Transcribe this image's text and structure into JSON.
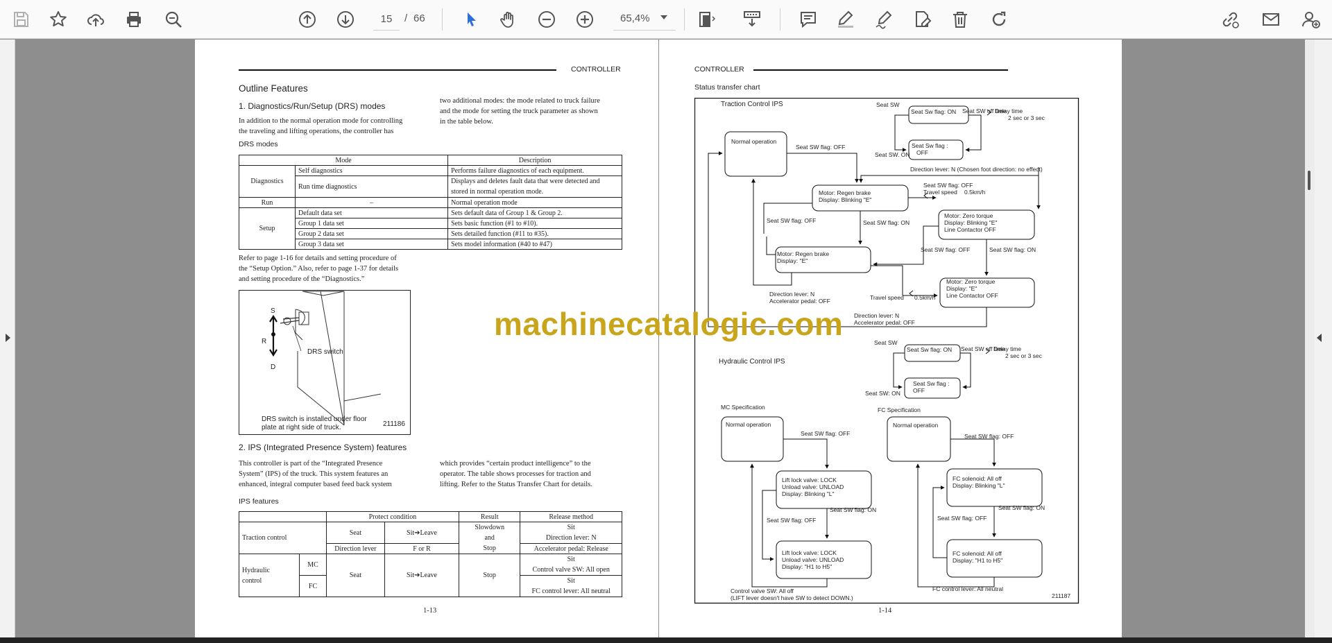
{
  "toolbar": {
    "current_page": "15",
    "page_sep": "/",
    "total_pages": "66",
    "zoom": "65,4%",
    "icons": [
      "save-icon",
      "bookmark-star-icon",
      "upload-cloud-icon",
      "print-icon",
      "zoom-search-icon",
      "page-up-icon",
      "page-down-icon",
      "select-cursor-icon",
      "hand-tool-icon",
      "zoom-out-icon",
      "zoom-in-icon",
      "fit-page-icon",
      "scroll-mode-icon",
      "comment-icon",
      "highlight-pen-icon",
      "sign-pen-icon",
      "edit-file-icon",
      "trash-icon",
      "rotate-icon",
      "share-link-icon",
      "mail-icon",
      "add-user-icon"
    ],
    "accent_color": "#2f6fd6"
  },
  "left_page": {
    "header": "CONTROLLER",
    "title": "Outline Features",
    "section1_title": "1.  Diagnostics/Run/Setup (DRS) modes",
    "para1_lines": [
      "In addition to the normal operation mode for controlling",
      "the traveling and lifting operations, the controller has"
    ],
    "para1b_lines": [
      "two additional modes: the mode related to truck failure",
      "and the mode for setting the truck parameter as shown",
      "in the table below."
    ],
    "drs_caption": "DRS modes",
    "drs_table": {
      "h_mode": "Mode",
      "h_desc": "Description",
      "diagnostics": "Diagnostics",
      "self_diag": "Self diagnostics",
      "self_diag_desc": "Performs failure diagnostics of each equipment.",
      "runtime_diag": "Run time diagnostics",
      "runtime_desc_1": "Displays and deletes fault data that were detected and",
      "runtime_desc_2": "stored in normal operation mode.",
      "run": "Run",
      "run_dash": "–",
      "run_desc": "Normal operation mode",
      "setup": "Setup",
      "default_set": "Default data set",
      "default_desc": "Sets default data of Group 1 & Group 2.",
      "g1": "Group 1 data set",
      "g1_desc": "Sets basic function (#1 to #10).",
      "g2": "Group 2 data set",
      "g2_desc": "Sets detailed function (#11 to #35).",
      "g3": "Group 3 data set",
      "g3_desc": "Sets model information  (#40 to #47)"
    },
    "para2_lines": [
      "Refer to page 1-16 for details and setting procedure of",
      "the “Setup Option.” Also, refer to page 1-37 for details",
      "and setting procedure of the “Diagnostics.”"
    ],
    "figure": {
      "s": "S",
      "r": "R",
      "d": "D",
      "switch_label": "DRS switch",
      "caption_1": "DRS switch is installed under floor",
      "caption_2": "plate at right side of truck.",
      "number": "211186"
    },
    "section2_title": "2.  IPS (Integrated Presence System) features",
    "para3_lines": [
      "This controller is part of the “Integrated Presence",
      "System” (IPS) of the truck. This system features an",
      "enhanced, integral computer based feed back system"
    ],
    "para3b_lines": [
      "which provides “certain product intelligence” to the",
      "operator. The table shows processes for traction and",
      "lifting. Refer to the Status Transfer Chart for details."
    ],
    "ips_caption": "IPS features",
    "ips_table": {
      "h_protect": "Protect condition",
      "h_result": "Result",
      "h_release": "Release method",
      "traction": "Traction control",
      "seat": "Seat",
      "sit_leave": "Sit➔Leave",
      "dir_lever": "Direction lever",
      "f_or_r": "F or R",
      "slowdown": "Slowdown",
      "and": "and",
      "stop": "Stop",
      "sit": "Sit",
      "dir_n": "Direction lever: N",
      "accel_release": "Accelerator pedal: Release",
      "hydraulic_1": "Hydraulic",
      "hydraulic_2": "control",
      "mc": "MC",
      "fc": "FC",
      "stop2": "Stop",
      "cv_open": "Control valve SW: All open",
      "fc_neutral": "FC control lever: All neutral"
    },
    "page_number": "1-13"
  },
  "right_page": {
    "header": "CONTROLLER",
    "chart_title": "Status transfer chart",
    "page_number": "1-14",
    "diagram": {
      "traction_title": "Traction Control IPS",
      "seat_sw": "Seat SW",
      "seat_flag_on": "Seat Sw flag: ON",
      "seat_flag_off_1": "Seat Sw flag :",
      "seat_flag_off_2": "OFF",
      "seat_off_time": "Seat SW off time",
      "delay_1": "Delay time",
      "delay_2": "2 sec or 3 sec",
      "seat_sw_on": "Seat SW. ON",
      "normal_op": "Normal operation",
      "seat_sw_flag_off": "Seat SW flag: OFF",
      "seat_sw_flag_on": "Seat SW flag: ON",
      "dir_lever_n_chosen": "Direction lever: N (Chosen foot direction: no effect)",
      "regen_blink_1": "Motor: Regen brake",
      "regen_blink_2": "Display: Blinking \"E\"",
      "travel_speed": "Travel speed",
      "speed_val": "0.5km/h",
      "zero_blink_1": "Motor: Zero torque",
      "zero_blink_2": "Display: Blinking \"E\"",
      "zero_blink_3": "Line Contactor OFF",
      "regen_e_1": "Motor: Regen brake",
      "regen_e_2": "Display:  \"E\"",
      "zero_e_1": "Motor: Zero torque",
      "zero_e_2": "Display:  \"E\"",
      "zero_e_3": "Line Contactor OFF",
      "dir_n": "Direction lever: N",
      "accel_off": "Accelerator pedal: OFF",
      "hydraulic_title": "Hydraulic Control IPS",
      "seat_sw_on2": "Seat SW: ON",
      "mc_spec": "MC Specification",
      "fc_spec": "FC Specification",
      "lift_blink_1": "Lift lock valve: LOCK",
      "lift_blink_2": "Unload valve: UNLOAD",
      "lift_blink_3": "Display: Blinking \"L\"",
      "lift_h_1": "Lift lock valve: LOCK",
      "lift_h_2": "Unload valve: UNLOAD",
      "lift_h_3": "Display: \"H1 to H5\"",
      "fc_blink_1": "FC solenoid: All off",
      "fc_blink_2": "Display: Blinking \"L\"",
      "fc_h_1": "FC solenoid: All off",
      "fc_h_2": "Display: \"H1 to H5\"",
      "cv_all_off": "Control valve SW: All off",
      "cv_note": "(LIFT lever doesn't have SW to detect DOWN.)",
      "fc_lever_neutral": "FC control lever: All neutral",
      "number": "211187"
    }
  },
  "watermark": "machinecatalogic.com"
}
